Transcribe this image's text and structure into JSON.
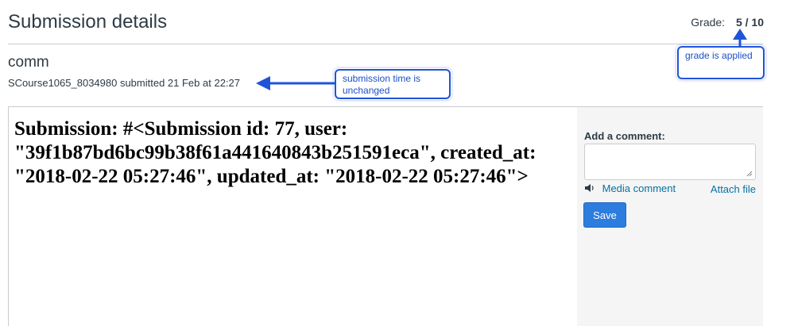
{
  "header": {
    "title": "Submission details",
    "grade_label": "Grade:",
    "grade_value": "5 / 10"
  },
  "assignment": {
    "name": "comm",
    "submitted_line": "SCourse1065_8034980 submitted 21 Feb at 22:27"
  },
  "submission": {
    "text": "Submission: #<Submission id: 77, user: \"39f1b87bd6bc99b38f61a441640843b251591eca\", created_at: \"2018-02-22 05:27:46\", updated_at: \"2018-02-22 05:27:46\">"
  },
  "sidebar": {
    "comment_label": "Add a comment:",
    "comment_value": "",
    "media_comment": "Media comment",
    "attach_file": "Attach file",
    "save_label": "Save"
  },
  "annotations": {
    "time_note": "submission time is unchanged",
    "grade_note": "grade is applied",
    "color": "#1f54d8"
  },
  "icons": [
    "speaker-icon",
    "resize-grip-icon"
  ]
}
